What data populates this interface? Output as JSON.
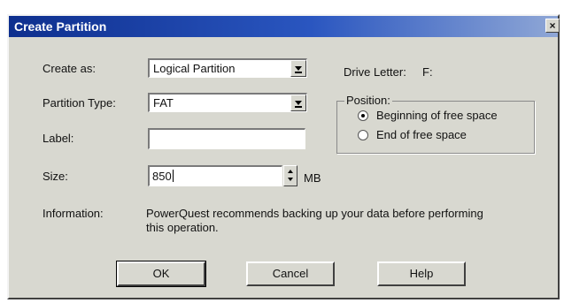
{
  "window": {
    "title": "Create Partition",
    "close_glyph": "×"
  },
  "form": {
    "create_as": {
      "label": "Create as:",
      "value": "Logical Partition"
    },
    "partition_type": {
      "label": "Partition Type:",
      "value": "FAT"
    },
    "label_field": {
      "label": "Label:",
      "value": ""
    },
    "size": {
      "label": "Size:",
      "value": "850",
      "unit": "MB"
    },
    "information": {
      "label": "Information:",
      "text_line1": "PowerQuest recommends backing up your data before performing",
      "text_line2": "this operation."
    }
  },
  "drive_letter": {
    "label": "Drive Letter:",
    "value": "F:"
  },
  "position": {
    "title": "Position:",
    "options": [
      {
        "label": "Beginning of free space",
        "selected": true
      },
      {
        "label": "End of free space",
        "selected": false
      }
    ]
  },
  "buttons": {
    "ok": "OK",
    "cancel": "Cancel",
    "help": "Help"
  },
  "icons": {
    "close": "close-icon",
    "dropdown": "chevron-down-icon",
    "spinner": "up-down-spinner-icon"
  }
}
